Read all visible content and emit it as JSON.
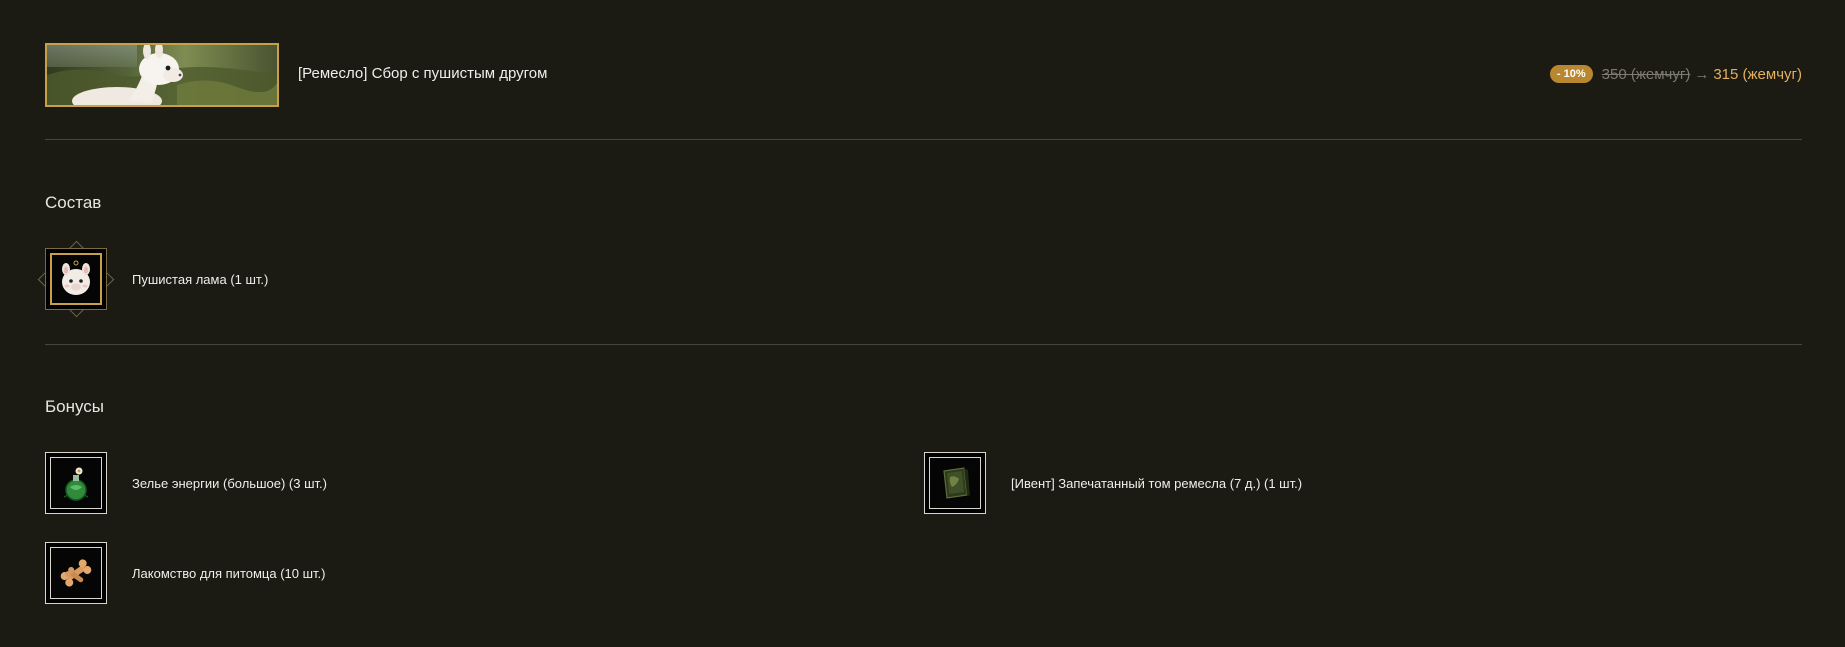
{
  "product": {
    "title": "[Ремесло] Сбор с пушистым другом",
    "discount": "- 10%",
    "old_price": "350 (жемчуг)",
    "arrow": "→",
    "new_price": "315 (жемчуг)"
  },
  "composition": {
    "title": "Состав",
    "items": [
      {
        "label": "Пушистая лама (1 шт.)",
        "icon": "llama-icon"
      }
    ]
  },
  "bonuses": {
    "title": "Бонусы",
    "items": [
      {
        "label": "Зелье энергии (большое) (3 шт.)",
        "icon": "energy-potion-icon"
      },
      {
        "label": "[Ивент] Запечатанный том ремесла (7 д.) (1 шт.)",
        "icon": "sealed-tome-icon"
      },
      {
        "label": "Лакомство для питомца (10 шт.)",
        "icon": "pet-treat-icon"
      }
    ]
  },
  "colors": {
    "background": "#1b1a13",
    "accent_gold": "#c9a04a",
    "new_price": "#e2b060",
    "discount_badge": "#b8872f"
  }
}
